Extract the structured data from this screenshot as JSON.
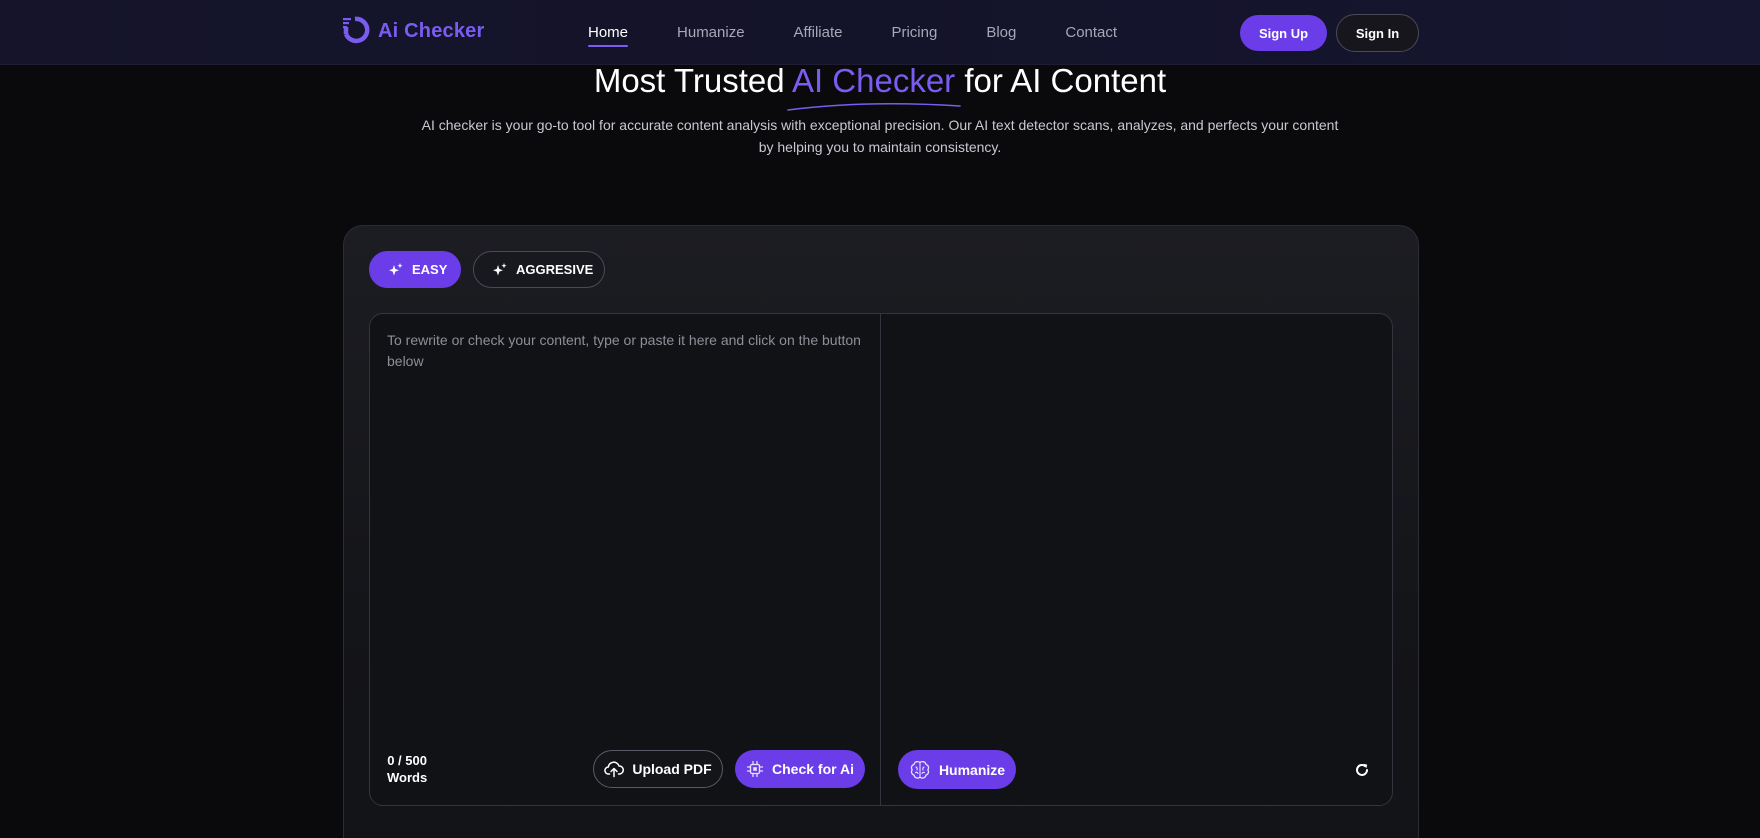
{
  "brand": {
    "name": "Ai Checker",
    "accent_color": "#7b5cf0",
    "button_color": "#6a3de8"
  },
  "nav": {
    "items": [
      {
        "label": "Home",
        "active": true
      },
      {
        "label": "Humanize",
        "active": false
      },
      {
        "label": "Affiliate",
        "active": false
      },
      {
        "label": "Pricing",
        "active": false
      },
      {
        "label": "Blog",
        "active": false
      },
      {
        "label": "Contact",
        "active": false
      }
    ]
  },
  "auth": {
    "signup_label": "Sign Up",
    "signin_label": "Sign In"
  },
  "hero": {
    "title_before": "Most Trusted ",
    "title_accent": "AI Checker",
    "title_after": " for AI Content",
    "subtitle": "AI checker is your go-to tool for accurate content analysis with exceptional precision. Our AI text detector scans, analyzes, and perfects your content by helping you to maintain consistency."
  },
  "tool": {
    "modes": [
      {
        "label": "EASY",
        "icon": "sparkle-icon",
        "selected": true
      },
      {
        "label": "AGGRESIVE",
        "icon": "sparkle-icon",
        "selected": false
      }
    ],
    "input": {
      "value": "",
      "placeholder": "To rewrite or check your content, type or paste it here and click on the button below"
    },
    "word_count": {
      "count": "0 / 500",
      "unit": "Words"
    },
    "upload_label": "Upload PDF",
    "check_label": "Check for Ai",
    "humanize_label": "Humanize",
    "icons": {
      "upload": "cloud-upload-icon",
      "check": "chip-icon",
      "humanize": "brain-icon",
      "reset": "refresh-icon"
    }
  }
}
